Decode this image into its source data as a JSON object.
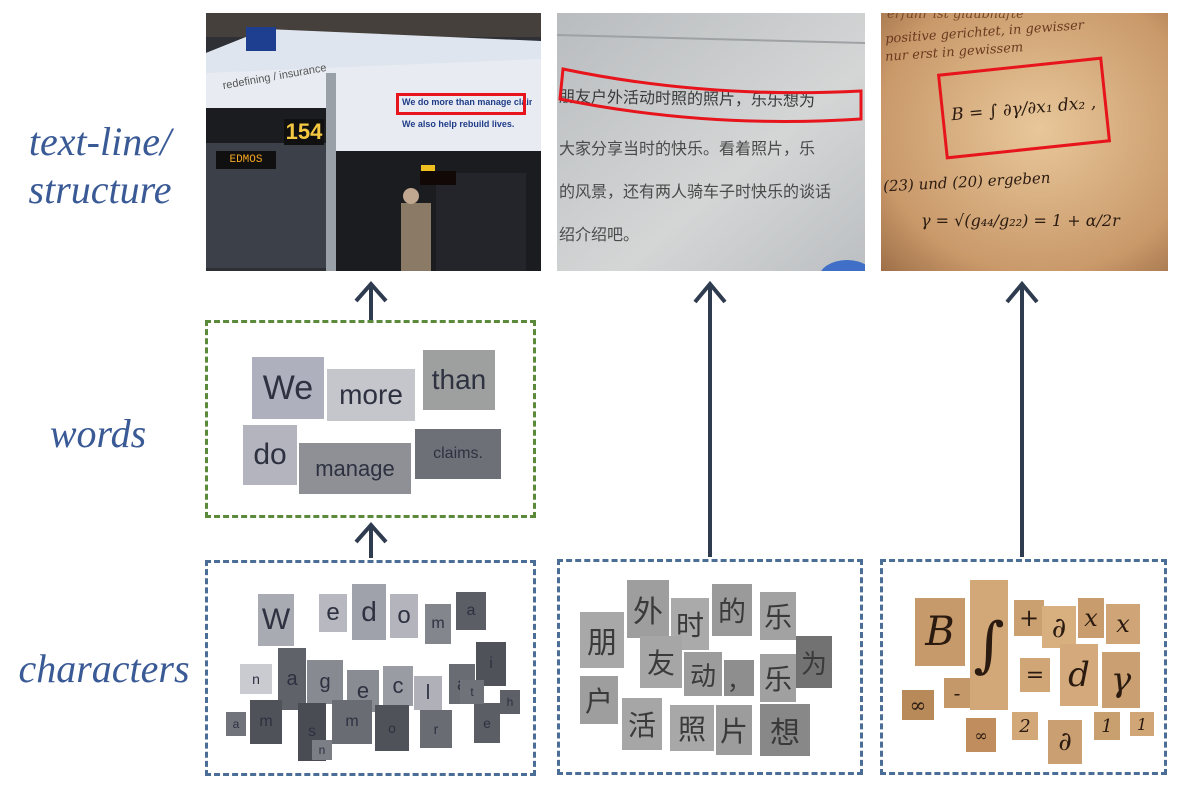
{
  "levels": {
    "structure": "text-line/\nstructure",
    "words": "words",
    "characters": "characters"
  },
  "photos": {
    "bus": {
      "brand": "redefining / insurance",
      "route_number": "154",
      "destination": "EDMOS",
      "line1": "We do more than manage claims.",
      "line2": "We also help rebuild lives."
    },
    "chinese_doc": {
      "lines": [
        "朋友户外活动时照的照片，乐乐想为",
        "大家分享当时的快乐。看着照片，乐",
        "的风景，还有两人骑车子时快乐的谈话",
        "绍介绍吧。"
      ]
    },
    "math_doc": {
      "top_lines": [
        "erfuhr ist glaubhafte",
        "positive gerichtet, in gewisser",
        "nur erst in gewissem"
      ],
      "formula": "B = ∫ ∂γ/∂x₁ dx₂ ,",
      "middle_line": "(23) und (20) ergeben",
      "bottom_formula": "γ = √(g₄₄/g₂₂) = 1 + α/2r"
    }
  },
  "words_crops": [
    "We",
    "more",
    "than",
    "do",
    "manage",
    "claims."
  ],
  "latin_char_crops": [
    "W",
    "e",
    "d",
    "o",
    "m",
    "a",
    "n",
    "a",
    "g",
    "e",
    "c",
    "l",
    "a",
    "i",
    "m",
    "s",
    "m",
    "o",
    "r",
    "e",
    "t",
    "h",
    "a",
    "n"
  ],
  "cjk_char_crops": [
    "朋",
    "外",
    "时",
    "的",
    "乐",
    "友",
    "动",
    "，",
    "乐",
    "为",
    "户",
    "活",
    "照",
    "片",
    "想"
  ],
  "math_char_crops": [
    "B",
    "∫",
    "+",
    "∂",
    "x",
    "x",
    "∞",
    "-",
    "=",
    "d",
    "γ",
    "∞",
    "2",
    "∂",
    "1",
    "1"
  ]
}
